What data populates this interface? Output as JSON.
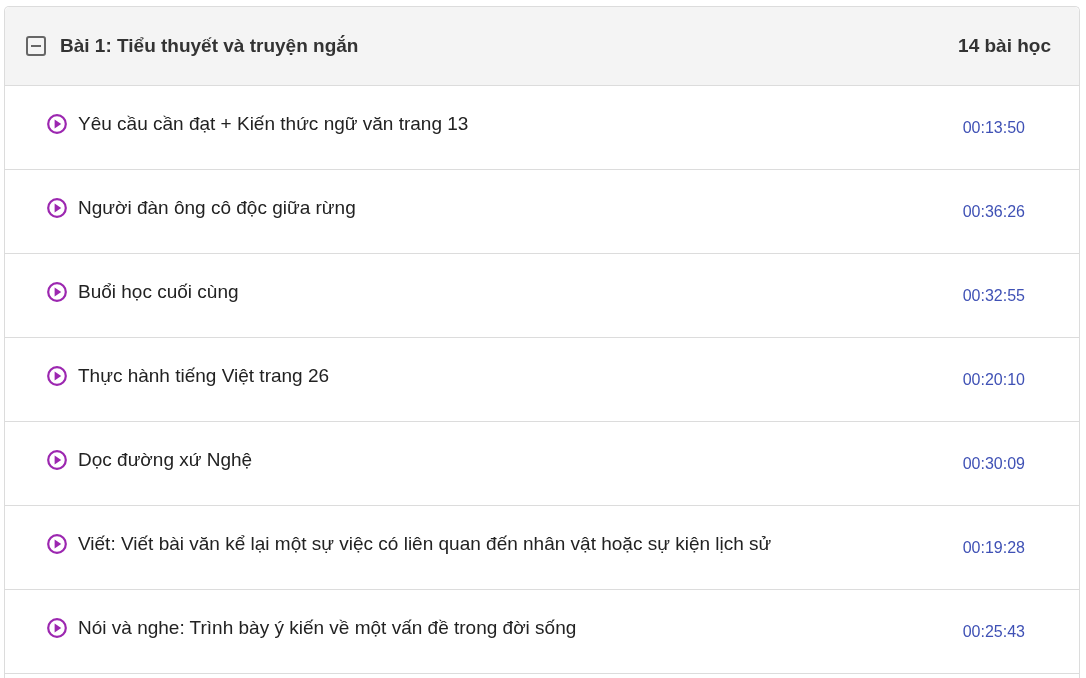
{
  "section": {
    "title": "Bài 1: Tiểu thuyết và truyện ngắn",
    "lesson_count": "14 bài học",
    "expanded": true
  },
  "lessons": [
    {
      "title": "Yêu cầu cần đạt + Kiến thức ngữ văn trang 13",
      "duration": "00:13:50"
    },
    {
      "title": "Người đàn ông cô độc giữa rừng",
      "duration": "00:36:26"
    },
    {
      "title": "Buổi học cuối cùng",
      "duration": "00:32:55"
    },
    {
      "title": "Thực hành tiếng Việt trang 26",
      "duration": "00:20:10"
    },
    {
      "title": "Dọc đường xứ Nghệ",
      "duration": "00:30:09"
    },
    {
      "title": "Viết: Viết bài văn kể lại một sự việc có liên quan đến nhân vật hoặc sự kiện lịch sử",
      "duration": "00:19:28"
    },
    {
      "title": "Nói và nghe: Trình bày ý kiến về một vấn đề trong đời sống",
      "duration": "00:25:43"
    }
  ]
}
